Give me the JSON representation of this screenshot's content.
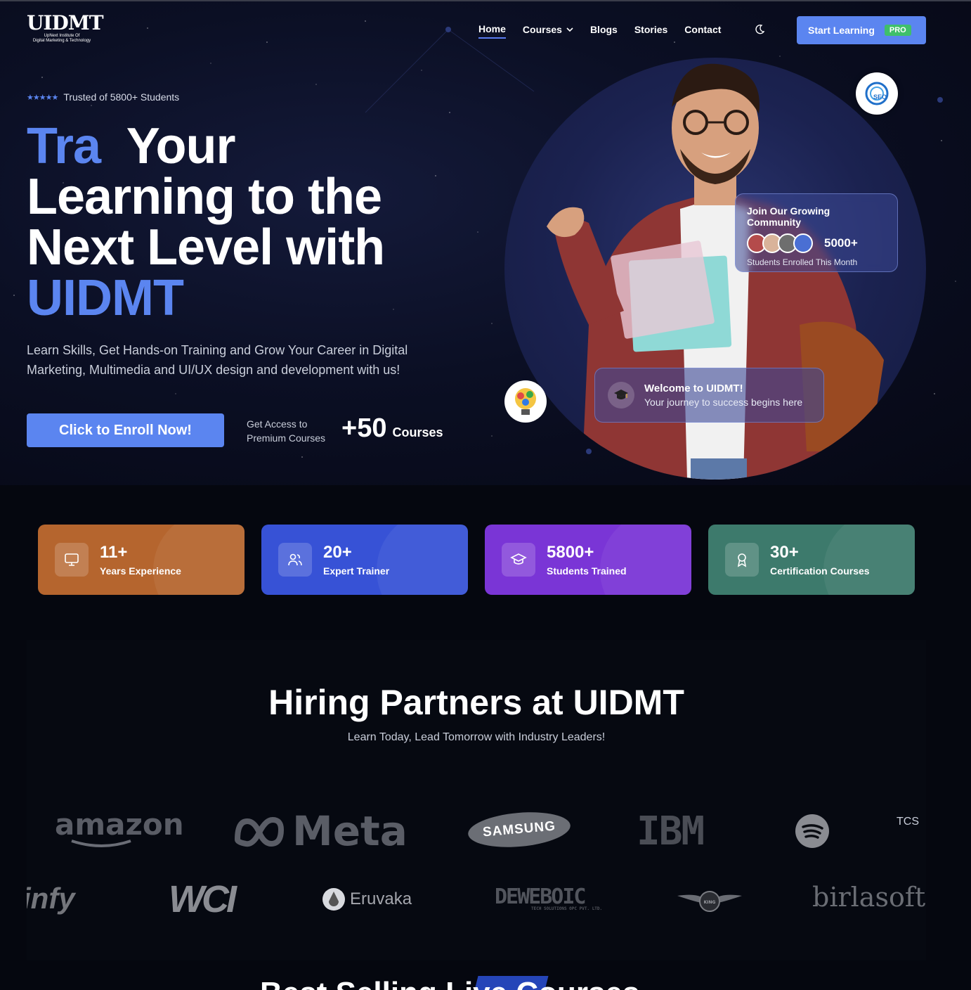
{
  "brand": {
    "logo_text": "UIDMT",
    "logo_sub_1": "UpNext Institute Of",
    "logo_sub_2": "Digital Marketing & Technology"
  },
  "nav": {
    "items": [
      {
        "label": "Home",
        "active": true
      },
      {
        "label": "Courses",
        "has_dropdown": true
      },
      {
        "label": "Blogs"
      },
      {
        "label": "Stories"
      },
      {
        "label": "Contact"
      }
    ],
    "theme_toggle_icon": "moon-icon",
    "cta_label": "Start Learning",
    "cta_badge": "PRO"
  },
  "hero": {
    "stars": "★★★★★",
    "trusted_text": "Trusted of 5800+ Students",
    "headline_accent_1": "Tra",
    "headline_rest_1": "Your",
    "headline_line_2": "Learning to the",
    "headline_line_3": "Next Level with",
    "headline_accent_2": "UIDMT",
    "subtext": "Learn Skills, Get Hands-on Training and Grow Your Career in Digital Marketing, Multimedia and UI/UX design and development with us!",
    "enroll_label": "Click to Enroll Now!",
    "access_text": "Get Access to Premium Courses",
    "courses_number": "+50",
    "courses_word": "Courses",
    "seo_badge_text": "SEO",
    "community": {
      "title": "Join Our Growing Community",
      "count": "5000+",
      "subtitle": "Students Enrolled This Month"
    },
    "welcome": {
      "title": "Welcome to UIDMT!",
      "subtitle": "Your journey to success begins here"
    }
  },
  "stats": [
    {
      "number": "11+",
      "label": "Years Experience",
      "icon": "monitor-icon",
      "color": "#b5652e"
    },
    {
      "number": "20+",
      "label": "Expert Trainer",
      "icon": "users-icon",
      "color": "#3752d6"
    },
    {
      "number": "5800+",
      "label": "Students Trained",
      "icon": "graduation-cap-icon",
      "color": "#7a35d6"
    },
    {
      "number": "30+",
      "label": "Certification Courses",
      "icon": "award-icon",
      "color": "#3d7a6c"
    }
  ],
  "partners": {
    "title": "Hiring Partners at UIDMT",
    "subtitle": "Learn Today, Lead Tomorrow with Industry Leaders!",
    "row1": [
      "amazon",
      "Meta",
      "SAMSUNG",
      "IBM",
      "spotify",
      "TCS"
    ],
    "row2": [
      "infy",
      "WCI",
      "Eruvaka",
      "DEWEBOIC",
      "KING",
      "birlasoft"
    ],
    "eruvaka_label": "Eruvaka",
    "deweboic_sub": "TECH SOLUTIONS OPC PVT. LTD."
  },
  "next_section_peek": "Best Selling Live Courses"
}
